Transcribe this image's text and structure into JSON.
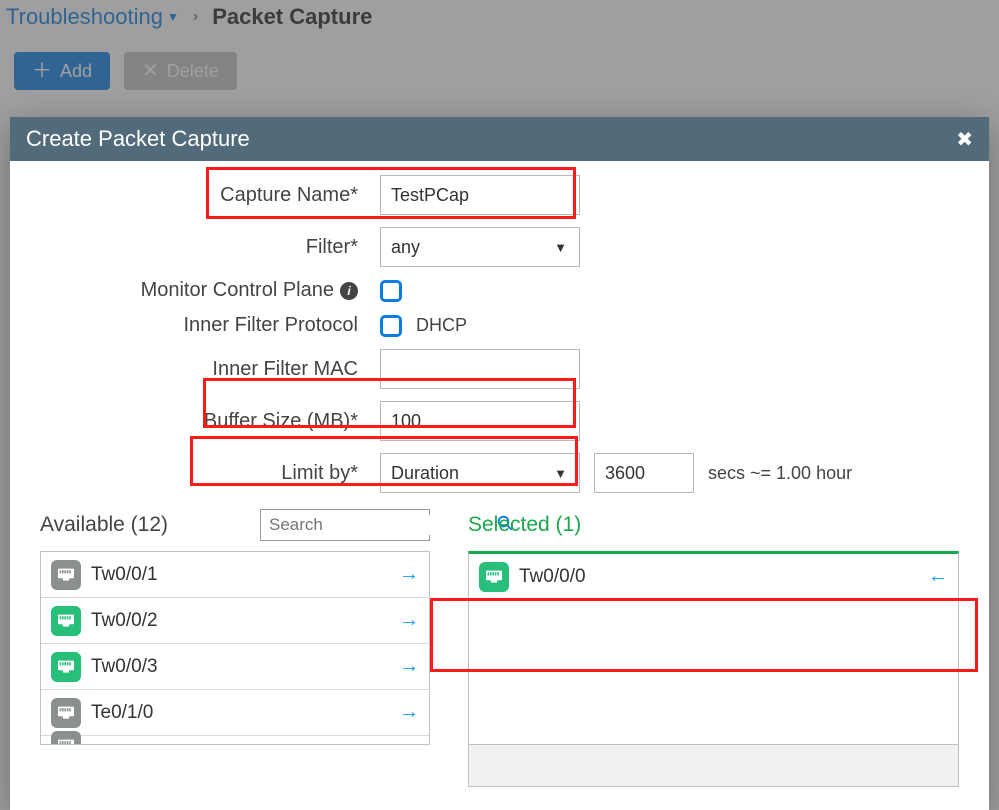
{
  "breadcrumb": {
    "parent": "Troubleshooting",
    "current": "Packet Capture"
  },
  "toolbar": {
    "add": "Add",
    "delete": "Delete"
  },
  "modal": {
    "title": "Create Packet Capture",
    "fields": {
      "capture_name": {
        "label": "Capture Name*",
        "value": "TestPCap"
      },
      "filter": {
        "label": "Filter*",
        "value": "any"
      },
      "monitor_ctrl": {
        "label": "Monitor Control Plane"
      },
      "inner_proto": {
        "label": "Inner Filter Protocol",
        "option": "DHCP"
      },
      "inner_mac": {
        "label": "Inner Filter MAC",
        "value": ""
      },
      "buffer": {
        "label": "Buffer Size (MB)*",
        "value": "100"
      },
      "limit": {
        "label": "Limit by*",
        "mode": "Duration",
        "value": "3600",
        "hint": "secs ~= 1.00 hour"
      }
    },
    "available": {
      "title": "Available (12)",
      "search_placeholder": "Search",
      "items": [
        {
          "name": "Tw0/0/1",
          "color": "gray"
        },
        {
          "name": "Tw0/0/2",
          "color": "green"
        },
        {
          "name": "Tw0/0/3",
          "color": "green"
        },
        {
          "name": "Te0/1/0",
          "color": "gray"
        }
      ]
    },
    "selected": {
      "title": "Selected (1)",
      "items": [
        {
          "name": "Tw0/0/0",
          "color": "green"
        }
      ]
    }
  }
}
